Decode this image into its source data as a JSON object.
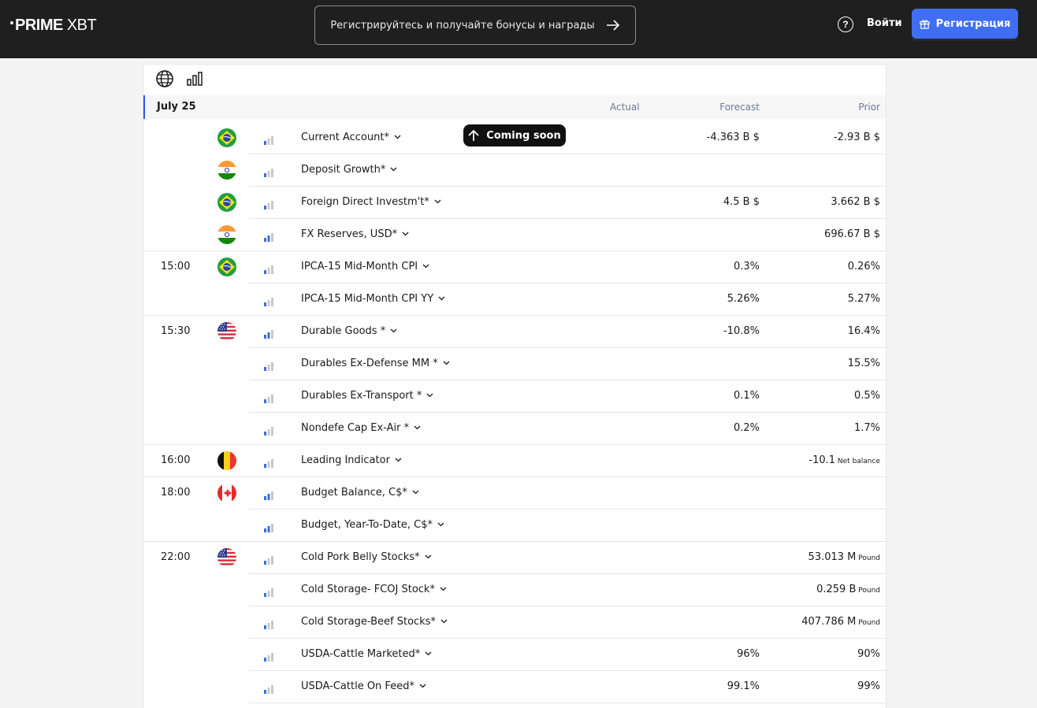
{
  "header": {
    "logo_prime": "PRIME",
    "logo_xbt": "XBT",
    "promo_text": "Регистрируйтесь и получайте бонусы и награды",
    "help_glyph": "?",
    "login_label": "Войти",
    "register_label": "Регистрация"
  },
  "tooltip": {
    "label": "Coming soon"
  },
  "calendar": {
    "date": "July 25",
    "col_actual": "Actual",
    "col_forecast": "Forecast",
    "col_prior": "Prior",
    "rows": [
      {
        "time": "",
        "flag": "brazil",
        "importance": "low",
        "name": "Current Account*",
        "forecast": "-4.363 B $",
        "prior": "-2.93 B $",
        "prior_unit": "",
        "divider": "part"
      },
      {
        "time": "",
        "flag": "india",
        "importance": "low",
        "name": "Deposit Growth*",
        "forecast": "",
        "prior": "",
        "prior_unit": "",
        "divider": "part"
      },
      {
        "time": "",
        "flag": "brazil",
        "importance": "low",
        "name": "Foreign Direct Investm't*",
        "forecast": "4.5 B $",
        "prior": "3.662 B $",
        "prior_unit": "",
        "divider": "part"
      },
      {
        "time": "",
        "flag": "india",
        "importance": "medium",
        "name": "FX Reserves, USD*",
        "forecast": "",
        "prior": "696.67 B $",
        "prior_unit": "",
        "divider": "full"
      },
      {
        "time": "15:00",
        "flag": "brazil",
        "importance": "low",
        "name": "IPCA-15 Mid-Month CPI",
        "forecast": "0.3%",
        "prior": "0.26%",
        "prior_unit": "",
        "divider": "part"
      },
      {
        "time": "",
        "flag": "",
        "importance": "low",
        "name": "IPCA-15 Mid-Month CPI YY",
        "forecast": "5.26%",
        "prior": "5.27%",
        "prior_unit": "",
        "divider": "full"
      },
      {
        "time": "15:30",
        "flag": "usa",
        "importance": "medium",
        "name": "Durable Goods *",
        "forecast": "-10.8%",
        "prior": "16.4%",
        "prior_unit": "",
        "divider": "part"
      },
      {
        "time": "",
        "flag": "",
        "importance": "low",
        "name": "Durables Ex-Defense MM *",
        "forecast": "",
        "prior": "15.5%",
        "prior_unit": "",
        "divider": "part"
      },
      {
        "time": "",
        "flag": "",
        "importance": "low",
        "name": "Durables Ex-Transport *",
        "forecast": "0.1%",
        "prior": "0.5%",
        "prior_unit": "",
        "divider": "part"
      },
      {
        "time": "",
        "flag": "",
        "importance": "low",
        "name": "Nondefe Cap Ex-Air *",
        "forecast": "0.2%",
        "prior": "1.7%",
        "prior_unit": "",
        "divider": "full"
      },
      {
        "time": "16:00",
        "flag": "belgium",
        "importance": "low",
        "name": "Leading Indicator",
        "forecast": "",
        "prior": "-10.1",
        "prior_unit": "Net balance",
        "divider": "full"
      },
      {
        "time": "18:00",
        "flag": "canada",
        "importance": "medium",
        "name": "Budget Balance, C$*",
        "forecast": "",
        "prior": "",
        "prior_unit": "",
        "divider": "part"
      },
      {
        "time": "",
        "flag": "",
        "importance": "medium",
        "name": "Budget, Year-To-Date, C$*",
        "forecast": "",
        "prior": "",
        "prior_unit": "",
        "divider": "full"
      },
      {
        "time": "22:00",
        "flag": "usa",
        "importance": "low",
        "name": "Cold Pork Belly Stocks*",
        "forecast": "",
        "prior": "53.013 M",
        "prior_unit": "Pound",
        "divider": "part"
      },
      {
        "time": "",
        "flag": "",
        "importance": "low",
        "name": "Cold Storage- FCOJ Stock*",
        "forecast": "",
        "prior": "0.259 B",
        "prior_unit": "Pound",
        "divider": "part"
      },
      {
        "time": "",
        "flag": "",
        "importance": "low",
        "name": "Cold Storage-Beef Stocks*",
        "forecast": "",
        "prior": "407.786 M",
        "prior_unit": "Pound",
        "divider": "part"
      },
      {
        "time": "",
        "flag": "",
        "importance": "low",
        "name": "USDA-Cattle Marketed*",
        "forecast": "96%",
        "prior": "90%",
        "prior_unit": "",
        "divider": "part"
      },
      {
        "time": "",
        "flag": "",
        "importance": "low",
        "name": "USDA-Cattle On Feed*",
        "forecast": "99.1%",
        "prior": "99%",
        "prior_unit": "",
        "divider": "part"
      }
    ]
  },
  "colors": {
    "accent": "#3f6ef5",
    "header_bg": "#1f1f1f",
    "importance_on": "#3b6fd8",
    "importance_off": "#c8c8c8"
  }
}
